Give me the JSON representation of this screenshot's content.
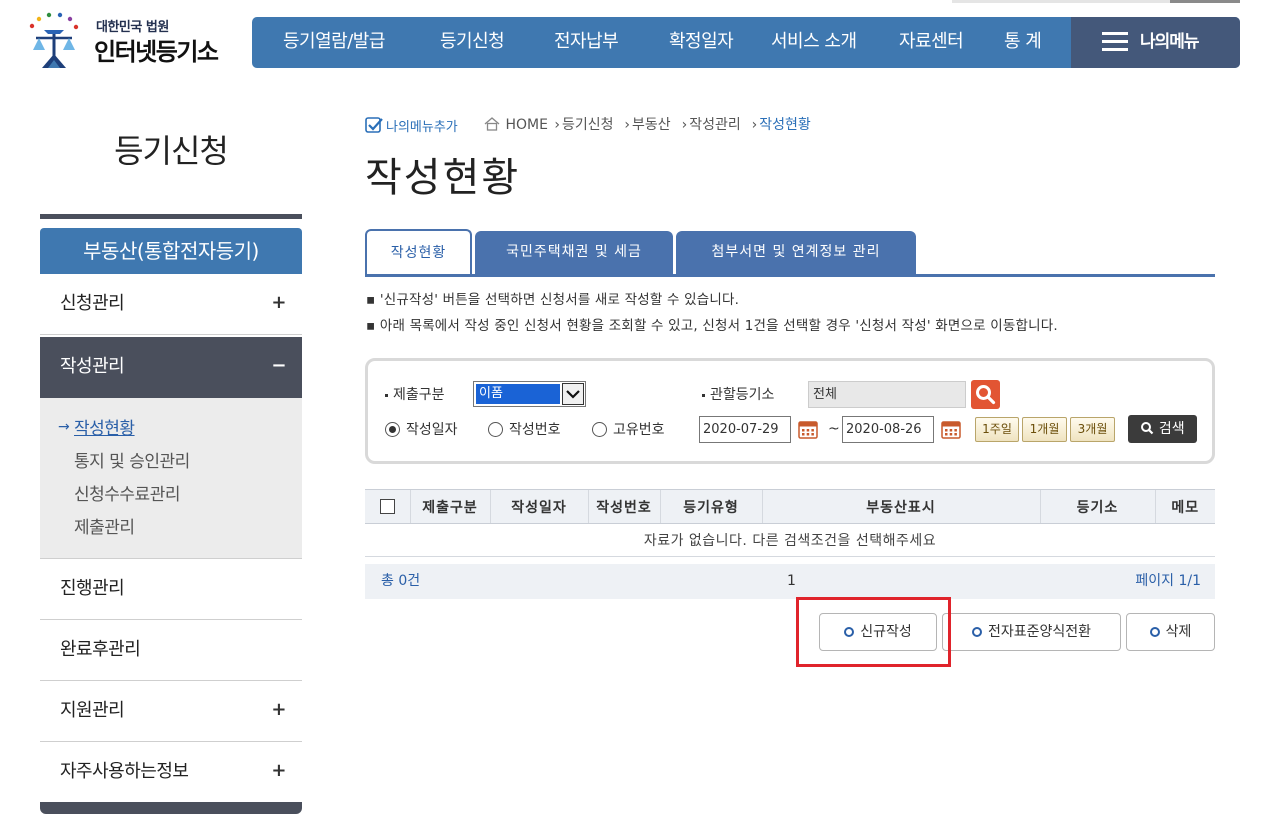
{
  "header": {
    "logo_top": "대한민국 법원",
    "logo_main": "인터넷등기소",
    "nav": [
      "등기열람/발급",
      "등기신청",
      "전자납부",
      "확정일자",
      "서비스 소개",
      "자료센터",
      "통 계"
    ],
    "my_menu": "나의메뉴",
    "colors": {
      "nav_bg": "#3f78b0",
      "my_menu_bg": "#44587a"
    }
  },
  "sidebar": {
    "title": "등기신청",
    "section": "부동산(통합전자등기)",
    "items": [
      {
        "label": "신청관리",
        "toggle": "+"
      },
      {
        "label": "작성관리",
        "toggle": "−"
      },
      {
        "label": "진행관리",
        "toggle": ""
      },
      {
        "label": "완료후관리",
        "toggle": ""
      },
      {
        "label": "지원관리",
        "toggle": "+"
      },
      {
        "label": "자주사용하는정보",
        "toggle": "+"
      }
    ],
    "sub_items": [
      "작성현황",
      "통지 및 승인관리",
      "신청수수료관리",
      "제출관리"
    ],
    "sub_arrow": "→"
  },
  "breadcrumb": {
    "my_menu_add": "나의메뉴추가",
    "items": [
      "HOME",
      "등기신청",
      "부동산",
      "작성관리",
      "작성현황"
    ]
  },
  "page_title": "작성현황",
  "tabs": [
    "작성현황",
    "국민주택채권 및 세금",
    "첨부서면 및 연계정보 관리"
  ],
  "notes": [
    "▪ '신규작성' 버튼을 선택하면 신청서를 새로 작성할 수 있습니다.",
    "▪ 아래 목록에서 작성 중인 신청서 현황을 조회할 수 있고, 신청서 1건을 선택할 경우 '신청서 작성' 화면으로 이동합니다."
  ],
  "search": {
    "submit_type_label": "제출구분",
    "submit_type_value": "이폼",
    "registry_label": "관할등기소",
    "registry_value": "전체",
    "radio_options": [
      "작성일자",
      "작성번호",
      "고유번호"
    ],
    "radio_selected": 0,
    "date_from": "2020-07-29",
    "date_to": "2020-08-26",
    "tilde": "~",
    "periods": [
      "1주일",
      "1개월",
      "3개월"
    ],
    "search_button": "검색"
  },
  "table": {
    "columns": [
      "제출구분",
      "작성일자",
      "작성번호",
      "등기유형",
      "부동산표시",
      "등기소",
      "메모"
    ],
    "empty_message": "자료가 없습니다. 다른 검색조건을 선택해주세요"
  },
  "pager": {
    "total": "총 0건",
    "page": "1",
    "page_info": "페이지 1/1"
  },
  "actions": [
    "신규작성",
    "전자표준양식전환",
    "삭제"
  ]
}
